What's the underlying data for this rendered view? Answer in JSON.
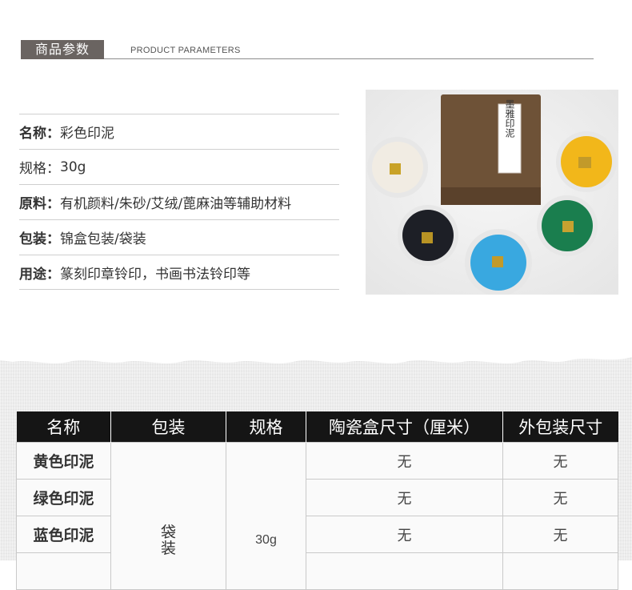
{
  "header": {
    "title_cn": "商品参数",
    "title_en": "PRODUCT PARAMETERS"
  },
  "params": [
    {
      "key": "名称：",
      "value": "彩色印泥"
    },
    {
      "key": "规格：",
      "value": "30g"
    },
    {
      "key": "原料：",
      "value": "有机颜料/朱砂/艾绒/蓖麻油等辅助材料"
    },
    {
      "key": "包装：",
      "value": "锦盒包装/袋装"
    },
    {
      "key": "用途：",
      "value": "篆刻印章铃印，书画书法铃印等"
    }
  ],
  "photo": {
    "box_label": "墨雅印泥",
    "colors": {
      "white": "#f1ece3",
      "yellow": "#f2b71a",
      "black": "#1d1f26",
      "blue": "#39a8e0",
      "green": "#1a7e4e",
      "box": "#6e5237"
    }
  },
  "table": {
    "headers": [
      "名称",
      "包装",
      "规格",
      "陶瓷盒尺寸（厘米）",
      "外包装尺寸"
    ],
    "rows": [
      {
        "name": "黄色印泥",
        "ceramic": "无",
        "outer": "无"
      },
      {
        "name": "绿色印泥",
        "ceramic": "无",
        "outer": "无"
      },
      {
        "name": "蓝色印泥",
        "ceramic": "无",
        "outer": "无"
      }
    ],
    "pack_value": "袋装",
    "spec_value": "30g"
  }
}
